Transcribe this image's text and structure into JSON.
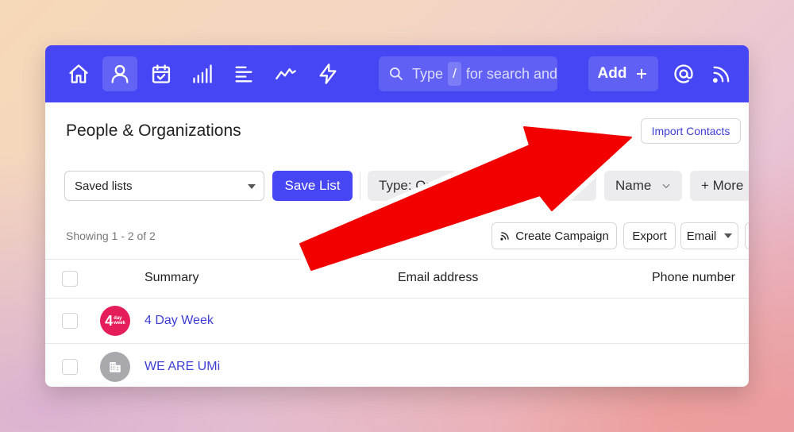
{
  "nav": {
    "icons": [
      "home-icon",
      "person-icon",
      "calendar-icon",
      "signal-bars-icon",
      "list-icon",
      "activity-icon",
      "lightning-icon",
      "at-icon",
      "rss-icon"
    ],
    "active": "person-icon"
  },
  "search": {
    "prefix": "Type",
    "key": "/",
    "suffix": "for search and"
  },
  "add_button": {
    "label": "Add",
    "icon": "plus-icon"
  },
  "page": {
    "title": "People & Organizations",
    "import_label": "Import Contacts"
  },
  "filters": {
    "saved_lists": "Saved lists",
    "save_list_label": "Save List",
    "type_filter": "Type: Or",
    "name_filter": "Name",
    "more_filter": "+ More"
  },
  "results": {
    "showing": "Showing 1 - 2 of 2",
    "actions": {
      "create_campaign": "Create Campaign",
      "export": "Export",
      "email": "Email"
    }
  },
  "table": {
    "headers": [
      "Summary",
      "Email address",
      "Phone number"
    ],
    "rows": [
      {
        "name": "4 Day Week",
        "avatar_main": "4",
        "avatar_sub_1": "day",
        "avatar_sub_2": "week"
      },
      {
        "name": "WE ARE UMi",
        "avatar_icon": "building-icon"
      }
    ]
  },
  "colors": {
    "brand": "#4646f4",
    "link": "#3d3dd6",
    "arrow": "#f20000"
  }
}
